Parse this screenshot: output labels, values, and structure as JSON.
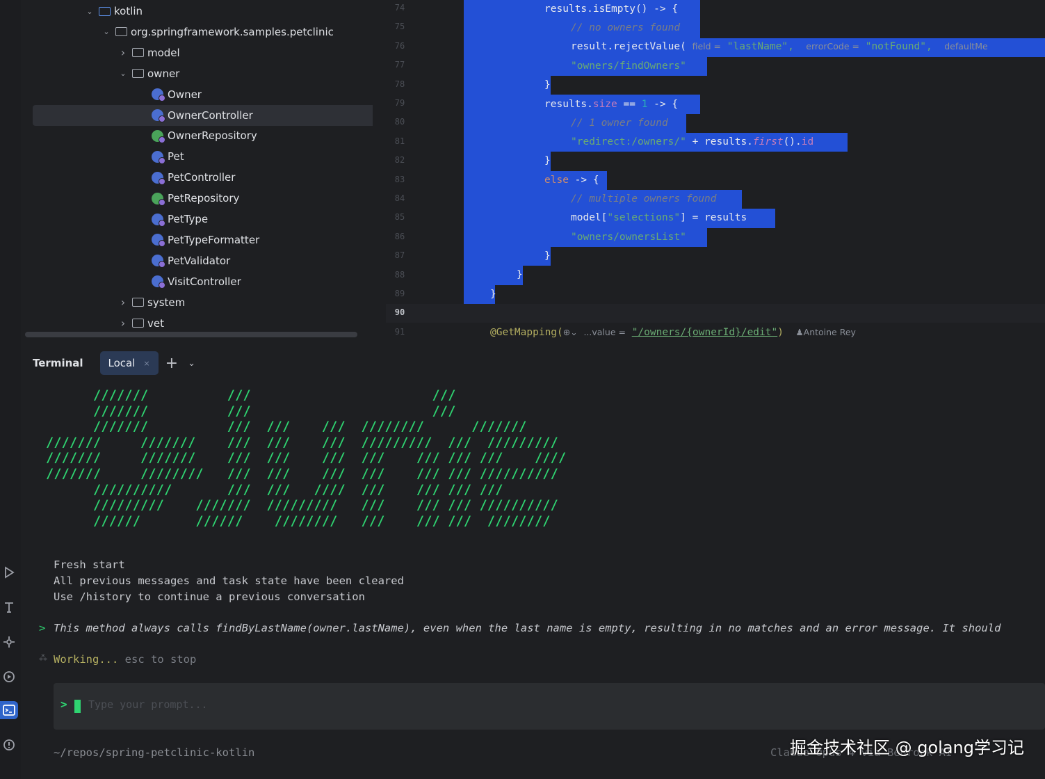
{
  "tree": {
    "items": [
      {
        "label": "kotlin",
        "indent": 0,
        "expanded": true,
        "kind": "folder"
      },
      {
        "label": "org.springframework.samples.petclinic",
        "indent": 1,
        "expanded": true,
        "kind": "package"
      },
      {
        "label": "model",
        "indent": 2,
        "expanded": false,
        "kind": "package"
      },
      {
        "label": "owner",
        "indent": 2,
        "expanded": true,
        "kind": "package"
      },
      {
        "label": "Owner",
        "indent": 3,
        "kind": "class"
      },
      {
        "label": "OwnerController",
        "indent": 3,
        "kind": "class",
        "selected": true
      },
      {
        "label": "OwnerRepository",
        "indent": 3,
        "kind": "interface"
      },
      {
        "label": "Pet",
        "indent": 3,
        "kind": "class"
      },
      {
        "label": "PetController",
        "indent": 3,
        "kind": "class"
      },
      {
        "label": "PetRepository",
        "indent": 3,
        "kind": "interface"
      },
      {
        "label": "PetType",
        "indent": 3,
        "kind": "class"
      },
      {
        "label": "PetTypeFormatter",
        "indent": 3,
        "kind": "class"
      },
      {
        "label": "PetValidator",
        "indent": 3,
        "kind": "class"
      },
      {
        "label": "VisitController",
        "indent": 3,
        "kind": "class"
      },
      {
        "label": "system",
        "indent": 2,
        "expanded": false,
        "kind": "package"
      },
      {
        "label": "vet",
        "indent": 2,
        "expanded": false,
        "kind": "package"
      }
    ]
  },
  "editor": {
    "line_numbers": [
      "74",
      "75",
      "76",
      "77",
      "78",
      "79",
      "80",
      "81",
      "82",
      "83",
      "84",
      "85",
      "86",
      "87",
      "88",
      "89",
      "90",
      "91"
    ],
    "current_line": "90",
    "code": {
      "l74": "results.isEmpty() -> {",
      "l75": "// no owners found",
      "l76a": "result.rejectValue(",
      "l76_hint_field": "field =",
      "l76_field": "\"lastName\",",
      "l76_hint_error": "errorCode =",
      "l76_error": "\"notFound\",",
      "l76_hint_default": "defaultMe",
      "l77": "\"owners/findOwners\"",
      "l78": "}",
      "l79a": "results.",
      "l79b": "size",
      "l79c": " == ",
      "l79d": "1",
      "l79e": " -> {",
      "l80": "// 1 owner found",
      "l81a": "\"redirect:/owners/\"",
      "l81b": " + results.",
      "l81c": "first",
      "l81d": "().",
      "l81e": "id",
      "l82": "}",
      "l83a": "else",
      "l83b": " -> {",
      "l84": "// multiple owners found",
      "l85a": "model[",
      "l85b": "\"selections\"",
      "l85c": "] = results",
      "l86": "\"owners/ownersList\"",
      "l87": "}",
      "l88": "}",
      "l89": "}",
      "l91a": "@GetMapping(",
      "l91_icon": "⊕⌄",
      "l91_hint": "...value =",
      "l91_path": "\"/owners/{ownerId}/edit\"",
      "l91b": ")",
      "l91_author": "Antoine Rey"
    }
  },
  "terminal": {
    "title": "Terminal",
    "tab_label": "Local",
    "tab_close": "×",
    "add_tab": "+",
    "dropdown": "⌄",
    "banner": "      ///////          ///                       ///\n      ///////          ///                       ///\n      ///////          ///  ///    ///  ////////      ///////\n///////     ///////    ///  ///    ///  /////////  ///  /////////\n///////     ///////    ///  ///    ///  ///    /// /// ///    ////\n///////     ////////   ///  ///    ///  ///    /// /// //////////\n      //////////       ///  ///   ////  ///    /// /// ///\n      /////////    ///////  /////////   ///    /// /// //////////\n      //////       //////    ////////   ///    /// ///  ////////",
    "fresh_start": "Fresh start",
    "cleared": "All previous messages and task state have been cleared",
    "history_hint": "Use /history to continue a previous conversation",
    "prompt_marker": ">",
    "message": "This method always calls findByLastName(owner.lastName), even when the last name is empty, resulting in no matches and an error message. It should",
    "working_marker": "⁂",
    "working": "Working...",
    "stop_hint": "esc to stop",
    "input_arrow": ">",
    "input_placeholder": "Type your prompt...",
    "cwd": "~/repos/spring-petclinic-kotlin",
    "status_right": "Claude Opus 4 via Bedrock AI"
  },
  "watermark": "掘金技术社区 @ golang学习记",
  "colors": {
    "accent": "#2f64c9",
    "selection": "#2350d6",
    "banner_green": "#2fd371",
    "background": "#1e1f22"
  }
}
